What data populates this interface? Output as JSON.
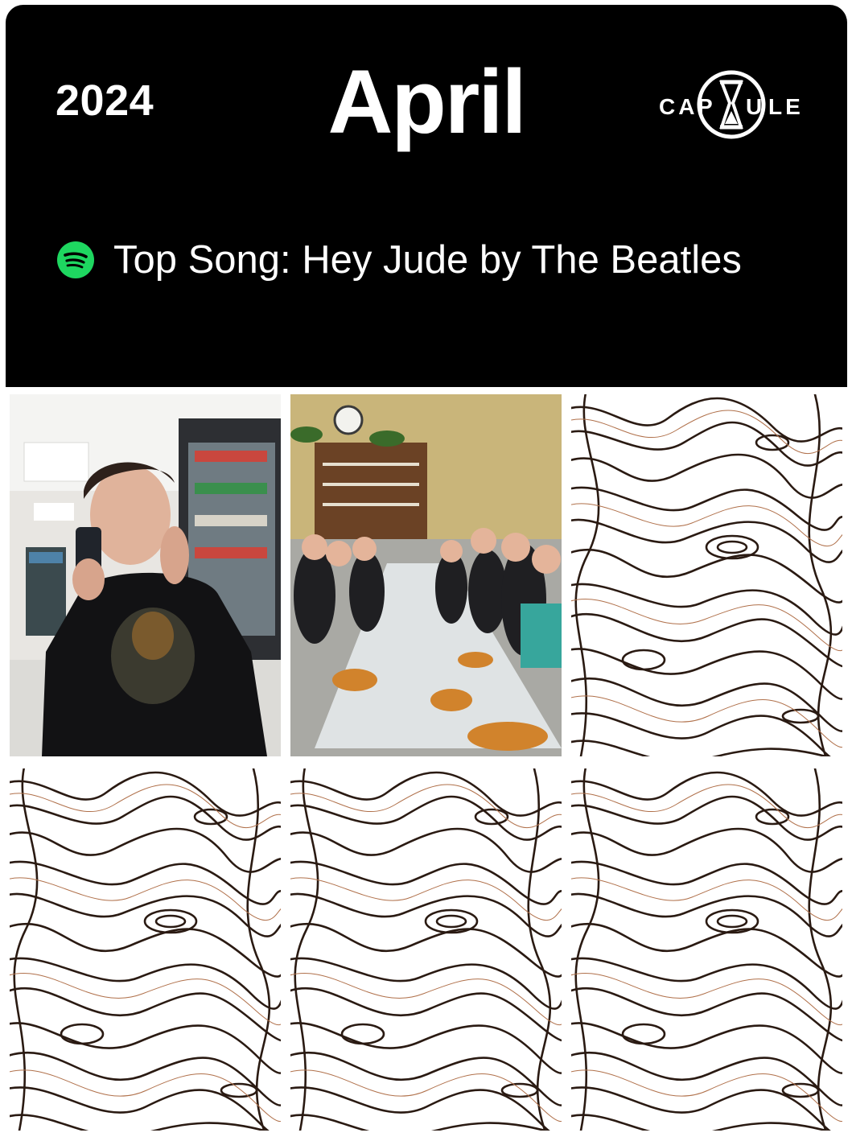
{
  "header": {
    "year": "2024",
    "month": "April",
    "logo_text": "CAPSULE",
    "background": "#000000"
  },
  "top_song": {
    "label": "Top Song: Hey Jude by The Beatles",
    "icon": "spotify-icon",
    "icon_color": "#1ED760"
  },
  "grid": {
    "tiles": [
      {
        "type": "photo",
        "content": "person-on-phone-in-store"
      },
      {
        "type": "photo",
        "content": "group-dinner-table"
      },
      {
        "type": "pattern",
        "content": "wood-grain-placeholder"
      },
      {
        "type": "pattern",
        "content": "wood-grain-placeholder"
      },
      {
        "type": "pattern",
        "content": "wood-grain-placeholder"
      },
      {
        "type": "pattern",
        "content": "wood-grain-placeholder"
      }
    ]
  }
}
